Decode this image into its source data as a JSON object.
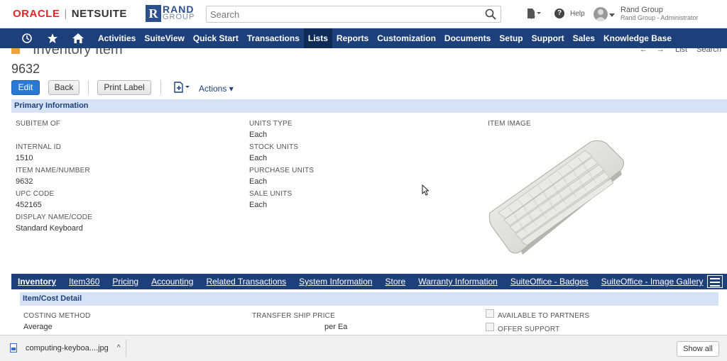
{
  "header": {
    "brand_oracle": "ORACLE",
    "brand_sep": "|",
    "brand_netsuite": "NETSUITE",
    "logo_mark": "R",
    "logo_line1": "RAND",
    "logo_line2": "GROUP",
    "search_placeholder": "Search",
    "help_label": "Help",
    "user_name": "Rand Group",
    "user_role": "Rand Group - Administrator"
  },
  "nav": {
    "items": [
      "Activities",
      "SuiteView",
      "Quick Start",
      "Transactions",
      "Lists",
      "Reports",
      "Customization",
      "Documents",
      "Setup",
      "Support",
      "Sales",
      "Knowledge Base"
    ],
    "active": "Lists"
  },
  "page": {
    "title": "Inventory Item",
    "list_link": "List",
    "search_link": "Search",
    "record_number": "9632"
  },
  "toolbar": {
    "edit": "Edit",
    "back": "Back",
    "print_label": "Print Label",
    "actions": "Actions"
  },
  "primary": {
    "header": "Primary Information",
    "col1": [
      {
        "label": "SUBITEM OF",
        "value": ""
      },
      {
        "label": "INTERNAL ID",
        "value": "1510"
      },
      {
        "label": "ITEM NAME/NUMBER",
        "value": "9632"
      },
      {
        "label": "UPC CODE",
        "value": "452165"
      },
      {
        "label": "DISPLAY NAME/CODE",
        "value": "Standard Keyboard"
      }
    ],
    "col2": [
      {
        "label": "UNITS TYPE",
        "value": "Each"
      },
      {
        "label": "STOCK UNITS",
        "value": "Each"
      },
      {
        "label": "PURCHASE UNITS",
        "value": "Each"
      },
      {
        "label": "SALE UNITS",
        "value": "Each"
      }
    ],
    "item_image_label": "ITEM IMAGE"
  },
  "subtabs": {
    "items": [
      "Inventory",
      "Item360",
      "Pricing",
      "Accounting",
      "Related Transactions",
      "System Information",
      "Store",
      "Warranty Information",
      "SuiteOffice - Badges",
      "SuiteOffice - Image Gallery"
    ],
    "active": "Inventory"
  },
  "cost_detail": {
    "header": "Item/Cost Detail",
    "costing_method_label": "COSTING METHOD",
    "costing_method_value": "Average",
    "transfer_price_label": "TRANSFER SHIP PRICE",
    "transfer_price_value": "per Ea",
    "available_to_partners": "AVAILABLE TO PARTNERS",
    "offer_support": "OFFER SUPPORT"
  },
  "download": {
    "filename": "computing-keyboa....jpg",
    "caret": "^",
    "show_all": "Show all"
  }
}
